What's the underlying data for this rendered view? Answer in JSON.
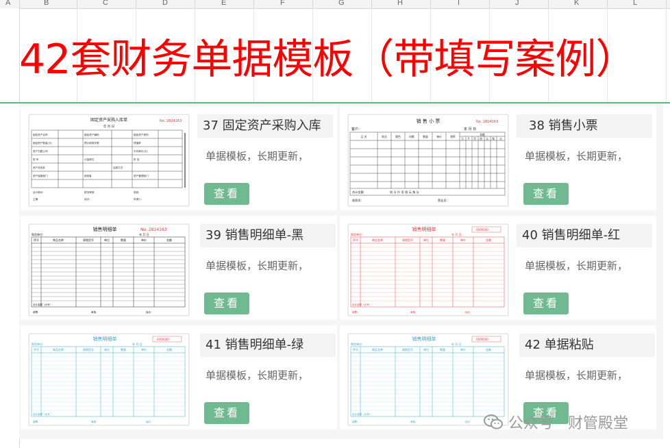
{
  "columns": [
    "A",
    "B",
    "C",
    "D",
    "E",
    "F",
    "G",
    "H",
    "I",
    "J",
    "K",
    "L"
  ],
  "title": "42套财务单据模板（带填写案例）",
  "cards": [
    {
      "name": "37 固定资产采购入库",
      "desc": "单据模板，长期更新，",
      "button": "查看",
      "thumb": {
        "heading": "固定资产采购入库单",
        "serial": "No. 2824163",
        "date": "年  月  日",
        "labels": [
          "固定资产名称",
          "固定资产编码",
          "固定资产类别",
          "固定资产数量(元)",
          "预计使用年限",
          "残值率",
          "资产归属公司",
          "平均单价(元)",
          "型  号",
          "计量单位",
          "折  旧",
          "资产存放处",
          "结算方式",
          "资产保管部门",
          "使用者",
          "资产管理部门",
          "合计单价:",
          "财务审核:",
          "验收:",
          "主管:",
          "经办:",
          "申请人:"
        ]
      }
    },
    {
      "name": "38 销售小票",
      "desc": "单据模板，长期更新，",
      "button": "查看",
      "thumb": {
        "heading": "销 售 小 票",
        "serial": "No. 2824163",
        "customer": "客户:",
        "date": "年   月   日",
        "headers": [
          "品 名",
          "款式",
          "颜色",
          "码数",
          "数量",
          "单价",
          "税率"
        ],
        "amount": "金额",
        "digits": [
          "万",
          "千",
          "百",
          "拾",
          "元",
          "角",
          "分"
        ],
        "total": "合计金额",
        "totalWords": "拾  万  仟  佰  拾  元  角  分",
        "receiver": "收款员:",
        "shop": "营业员:"
      }
    },
    {
      "name": "39 销售明细单-黑",
      "desc": "单据模板，长期更新，",
      "button": "查看",
      "thumb": {
        "heading": "销售明细单",
        "serial": "No. 2824163",
        "buyer": "购货单位:",
        "date": "年   月   日",
        "headers": [
          "序号",
          "商品名称",
          "规格型号",
          "单位",
          "数量",
          "单价",
          "金额"
        ],
        "total": "合计金额（大写）:",
        "footer": [
          "填票:",
          "审核:",
          "经办:"
        ]
      }
    },
    {
      "name": "40 销售明细单-红",
      "desc": "单据模板，长期更新，",
      "button": "查看",
      "thumb": {
        "heading": "销售明细单",
        "serial": "0000000",
        "buyer": "购货单位:",
        "date": "年   月   日",
        "headers": [
          "序号",
          "商品名称",
          "规格型号",
          "单位",
          "数量",
          "单价",
          "金额"
        ],
        "total": "合计金额（大写）:",
        "footer": [
          "填票:",
          "审核:",
          "经办:"
        ]
      }
    },
    {
      "name": "41 销售明细单-绿",
      "desc": "单据模板，长期更新，",
      "button": "查看",
      "thumb": {
        "heading": "销售明细单",
        "serial": "0000000",
        "buyer": "购货单位:",
        "date": "年   月   日",
        "headers": [
          "序号",
          "商品名称",
          "规格型号",
          "单位",
          "数量",
          "单价",
          "金额"
        ],
        "total": "合计金额（大写）:",
        "footer": [
          "填票:",
          "审核:",
          "经办:"
        ]
      }
    },
    {
      "name": "42 单据粘贴",
      "desc": "单据模板，长期更新，",
      "button": "查看",
      "thumb": {
        "heading": "销售明细单",
        "serial": "0000000",
        "buyer": "购货单位:",
        "date": "年   月   日",
        "headers": [
          "序号",
          "商品名称",
          "规格型号",
          "单位",
          "数量",
          "单价",
          "金额"
        ],
        "total": "合计金额（大写）:",
        "footer": [
          "填票:",
          "审核:",
          "经办:"
        ]
      }
    }
  ],
  "watermark": "公众号 · 财管殿堂",
  "colors": {
    "title": "#ff0000",
    "button": "#6fba91",
    "divider": "#5fb87c",
    "black": "#222222",
    "red": "#e23a3a",
    "teal": "#35a6c8"
  }
}
